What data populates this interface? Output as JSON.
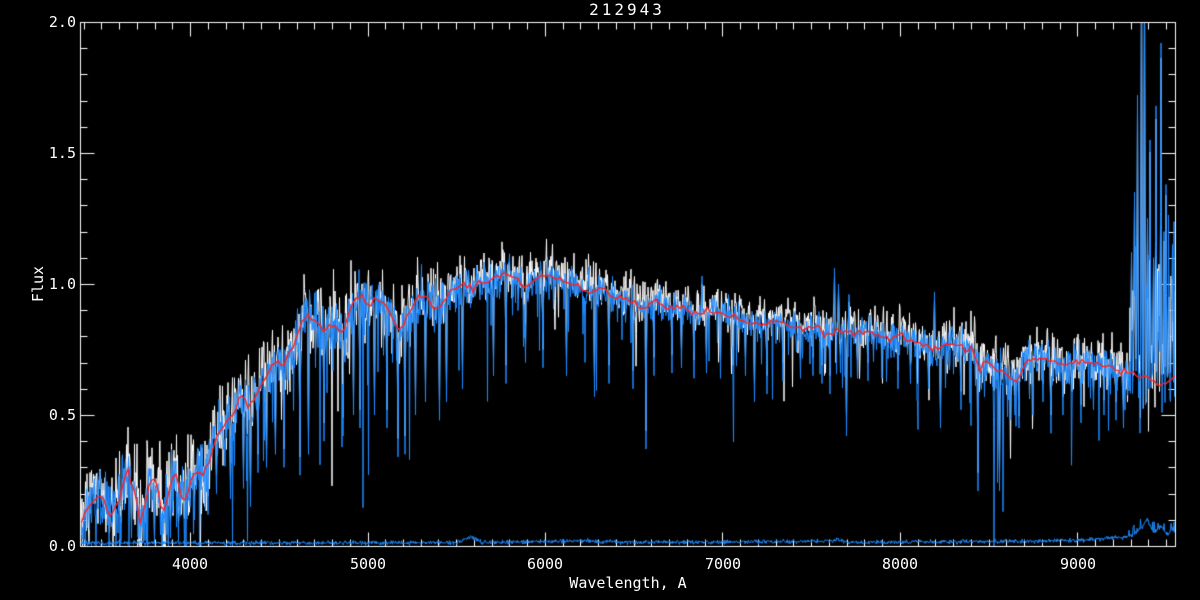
{
  "window": {
    "background": "#000000"
  },
  "chart_data": {
    "type": "line",
    "title": "212943",
    "xlabel": "Wavelength, A",
    "ylabel": "Flux",
    "xlim": [
      3380,
      9550
    ],
    "ylim": [
      0.0,
      2.0
    ],
    "grid": false,
    "legend": "none",
    "x_ticks": {
      "major": [
        4000,
        5000,
        6000,
        7000,
        8000,
        9000
      ],
      "labels": [
        "4000",
        "5000",
        "6000",
        "7000",
        "8000",
        "9000"
      ],
      "minor_step": 100
    },
    "y_ticks": {
      "major": [
        0.0,
        0.5,
        1.0,
        1.5,
        2.0
      ],
      "labels": [
        "0.0",
        "0.5",
        "1.0",
        "1.5",
        "2.0"
      ],
      "minor_step": 0.1
    },
    "colors": {
      "background": "#000000",
      "axis": "#ffffff",
      "observed_spectrum": "#1e8bff",
      "unsmoothed_spectrum": "#ffffff",
      "template_fit": "#ff2020"
    },
    "series": [
      {
        "name": "template_fit_continuum",
        "type": "line",
        "color": "#ff2020",
        "x": [
          3380,
          3420,
          3460,
          3490,
          3525,
          3555,
          3600,
          3650,
          3690,
          3718,
          3745,
          3774,
          3810,
          3847,
          3880,
          3915,
          3950,
          3990,
          4030,
          4070,
          4110,
          4150,
          4200,
          4250,
          4290,
          4340,
          4390,
          4440,
          4480,
          4520,
          4570,
          4620,
          4660,
          4700,
          4760,
          4810,
          4860,
          4910,
          4960,
          5010,
          5060,
          5110,
          5170,
          5230,
          5280,
          5330,
          5380,
          5430,
          5480,
          5540,
          5600,
          5660,
          5720,
          5780,
          5840,
          5890,
          5950,
          6010,
          6070,
          6130,
          6190,
          6250,
          6310,
          6370,
          6430,
          6490,
          6560,
          6620,
          6680,
          6740,
          6800,
          6860,
          6920,
          6980,
          7040,
          7100,
          7160,
          7220,
          7280,
          7340,
          7400,
          7460,
          7520,
          7580,
          7640,
          7700,
          7760,
          7820,
          7880,
          7940,
          8000,
          8060,
          8120,
          8180,
          8240,
          8300,
          8360,
          8420,
          8450,
          8480,
          8540,
          8600,
          8660,
          8700,
          8760,
          8820,
          8880,
          8940,
          9000,
          9060,
          9120,
          9180,
          9240,
          9300,
          9360,
          9420,
          9470,
          9510,
          9550
        ],
        "y": [
          0.09,
          0.13,
          0.18,
          0.21,
          0.15,
          0.11,
          0.18,
          0.29,
          0.2,
          0.09,
          0.15,
          0.25,
          0.25,
          0.11,
          0.2,
          0.3,
          0.17,
          0.21,
          0.3,
          0.26,
          0.33,
          0.42,
          0.47,
          0.52,
          0.58,
          0.53,
          0.6,
          0.66,
          0.71,
          0.69,
          0.75,
          0.83,
          0.89,
          0.86,
          0.82,
          0.86,
          0.81,
          0.92,
          0.96,
          0.92,
          0.95,
          0.91,
          0.82,
          0.88,
          0.94,
          0.95,
          0.9,
          0.94,
          0.97,
          1.0,
          0.98,
          1.01,
          1.02,
          1.04,
          1.02,
          0.99,
          1.02,
          1.03,
          1.02,
          1.01,
          0.99,
          0.97,
          0.98,
          0.96,
          0.95,
          0.93,
          0.9,
          0.94,
          0.92,
          0.91,
          0.9,
          0.88,
          0.9,
          0.89,
          0.88,
          0.87,
          0.85,
          0.84,
          0.86,
          0.85,
          0.84,
          0.83,
          0.84,
          0.81,
          0.82,
          0.82,
          0.81,
          0.82,
          0.8,
          0.79,
          0.8,
          0.79,
          0.77,
          0.75,
          0.76,
          0.77,
          0.76,
          0.74,
          0.67,
          0.71,
          0.68,
          0.66,
          0.63,
          0.7,
          0.72,
          0.71,
          0.7,
          0.69,
          0.7,
          0.7,
          0.69,
          0.68,
          0.67,
          0.66,
          0.65,
          0.63,
          0.61,
          0.64,
          0.65
        ]
      },
      {
        "name": "noise_floor_spectrum",
        "type": "line",
        "color": "#1e8bff",
        "x": [
          3380,
          5500,
          5577,
          5650,
          6270,
          6310,
          6364,
          6420,
          7580,
          7640,
          7720,
          8300,
          8700,
          9000,
          9150,
          9250,
          9310,
          9360,
          9395,
          9430,
          9470,
          9510,
          9550
        ],
        "y": [
          0.012,
          0.012,
          0.034,
          0.013,
          0.02,
          0.014,
          0.02,
          0.013,
          0.018,
          0.024,
          0.014,
          0.016,
          0.018,
          0.022,
          0.028,
          0.032,
          0.04,
          0.07,
          0.1,
          0.05,
          0.075,
          0.045,
          0.055
        ]
      }
    ],
    "absorption_spikes": [
      [
        3610,
        0.02
      ],
      [
        3670,
        0.03
      ],
      [
        3745,
        0.02
      ],
      [
        3800,
        0.01
      ],
      [
        3842,
        0.02
      ],
      [
        3890,
        0.03
      ],
      [
        3935,
        0.02
      ],
      [
        3970,
        0.04
      ],
      [
        4025,
        0.1
      ],
      [
        4101,
        0.12
      ],
      [
        4150,
        0.2
      ],
      [
        4227,
        0.18
      ],
      [
        4300,
        0.22
      ],
      [
        4340,
        0.15
      ],
      [
        4383,
        0.28
      ],
      [
        4430,
        0.3
      ],
      [
        4481,
        0.35
      ],
      [
        4530,
        0.3
      ],
      [
        4620,
        0.27
      ],
      [
        4668,
        0.35
      ],
      [
        4755,
        0.4
      ],
      [
        4861,
        0.42
      ],
      [
        4920,
        0.5
      ],
      [
        4957,
        0.45
      ],
      [
        5040,
        0.5
      ],
      [
        5110,
        0.45
      ],
      [
        5172,
        0.34
      ],
      [
        5210,
        0.35
      ],
      [
        5270,
        0.5
      ],
      [
        5328,
        0.55
      ],
      [
        5405,
        0.48
      ],
      [
        5446,
        0.55
      ],
      [
        5535,
        0.6
      ],
      [
        5710,
        0.65
      ],
      [
        5780,
        0.62
      ],
      [
        5890,
        0.7
      ],
      [
        5990,
        0.68
      ],
      [
        6122,
        0.65
      ],
      [
        6280,
        0.57
      ],
      [
        6360,
        0.62
      ],
      [
        6495,
        0.6
      ],
      [
        6570,
        0.37
      ],
      [
        6613,
        0.65
      ],
      [
        6717,
        0.66
      ],
      [
        6770,
        0.68
      ],
      [
        6840,
        0.64
      ],
      [
        6910,
        0.66
      ],
      [
        6990,
        0.64
      ],
      [
        7060,
        0.62
      ],
      [
        7130,
        0.65
      ],
      [
        7180,
        0.55
      ],
      [
        7250,
        0.58
      ],
      [
        7340,
        0.63
      ],
      [
        7440,
        0.64
      ],
      [
        7510,
        0.65
      ],
      [
        7560,
        0.62
      ],
      [
        7605,
        0.58
      ],
      [
        7665,
        0.66
      ],
      [
        7700,
        0.42
      ],
      [
        7760,
        0.64
      ],
      [
        7820,
        0.63
      ],
      [
        7900,
        0.64
      ],
      [
        7990,
        0.6
      ],
      [
        8060,
        0.62
      ],
      [
        8100,
        0.55
      ],
      [
        8160,
        0.6
      ],
      [
        8230,
        0.45
      ],
      [
        8344,
        0.52
      ],
      [
        8440,
        0.21
      ],
      [
        8560,
        0.21
      ],
      [
        8620,
        0.48
      ],
      [
        8670,
        0.45
      ],
      [
        8750,
        0.5
      ],
      [
        8805,
        0.55
      ],
      [
        8850,
        0.43
      ],
      [
        8920,
        0.5
      ],
      [
        8970,
        0.52
      ],
      [
        9020,
        0.47
      ],
      [
        9090,
        0.52
      ],
      [
        9150,
        0.5
      ],
      [
        9218,
        0.48
      ],
      [
        9260,
        0.45
      ]
    ],
    "emission_spikes": [
      [
        6884,
        1.03
      ],
      [
        7630,
        1.06
      ],
      [
        7655,
        1.0
      ],
      [
        7712,
        0.96
      ],
      [
        8195,
        0.97
      ],
      [
        9305,
        1.12
      ],
      [
        9322,
        1.35
      ],
      [
        9340,
        1.72
      ],
      [
        9360,
        2.35
      ],
      [
        9378,
        2.2
      ],
      [
        9395,
        1.25
      ],
      [
        9410,
        1.55
      ],
      [
        9428,
        1.1
      ],
      [
        9442,
        1.68
      ],
      [
        9458,
        1.05
      ],
      [
        9472,
        1.92
      ],
      [
        9487,
        1.2
      ],
      [
        9500,
        1.38
      ],
      [
        9515,
        0.98
      ],
      [
        9532,
        1.05
      ]
    ],
    "noise_model": {
      "regions": [
        {
          "from": 3380,
          "to": 4150,
          "sigma": 0.06,
          "spike_p": 0.16,
          "spike_depth": 0.13
        },
        {
          "from": 4150,
          "to": 5450,
          "sigma": 0.05,
          "spike_p": 0.16,
          "spike_depth": 0.16
        },
        {
          "from": 5450,
          "to": 6520,
          "sigma": 0.034,
          "spike_p": 0.1,
          "spike_depth": 0.1
        },
        {
          "from": 6520,
          "to": 7450,
          "sigma": 0.028,
          "spike_p": 0.1,
          "spike_depth": 0.1
        },
        {
          "from": 7450,
          "to": 8250,
          "sigma": 0.032,
          "spike_p": 0.11,
          "spike_depth": 0.1
        },
        {
          "from": 8250,
          "to": 9280,
          "sigma": 0.038,
          "spike_p": 0.12,
          "spike_depth": 0.12
        },
        {
          "from": 9280,
          "to": 9550,
          "sigma": 0.07,
          "spike_p": 0.18,
          "spike_depth": 0.12,
          "up_p": 0.22,
          "up_amp": 0.5
        }
      ],
      "white_sigma_scale": 1.35,
      "white_offset": 0.022
    }
  }
}
